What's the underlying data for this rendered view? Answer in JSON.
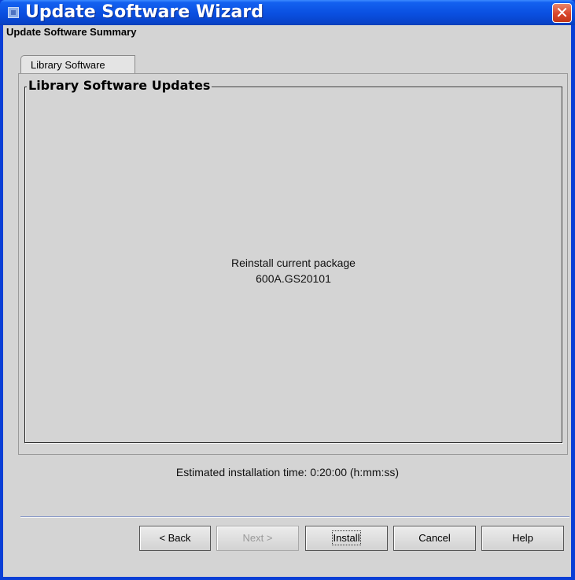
{
  "window": {
    "title": "Update Software Wizard",
    "close_symbol": "✕"
  },
  "page": {
    "summary_title": "Update Software Summary",
    "tab_label": "Library Software",
    "group_title": "Library Software Updates",
    "message_line1": "Reinstall current package",
    "message_line2": "600A.GS20101",
    "estimated_time": "Estimated installation time: 0:20:00 (h:mm:ss)"
  },
  "buttons": {
    "back": "< Back",
    "next": "Next >",
    "install": "Install",
    "cancel": "Cancel",
    "help": "Help"
  },
  "colors": {
    "titlebar": "#0a4fe0",
    "close": "#d9452a",
    "background": "#d4d4d4"
  },
  "icons": {
    "app": "app-icon",
    "close": "close-icon"
  }
}
